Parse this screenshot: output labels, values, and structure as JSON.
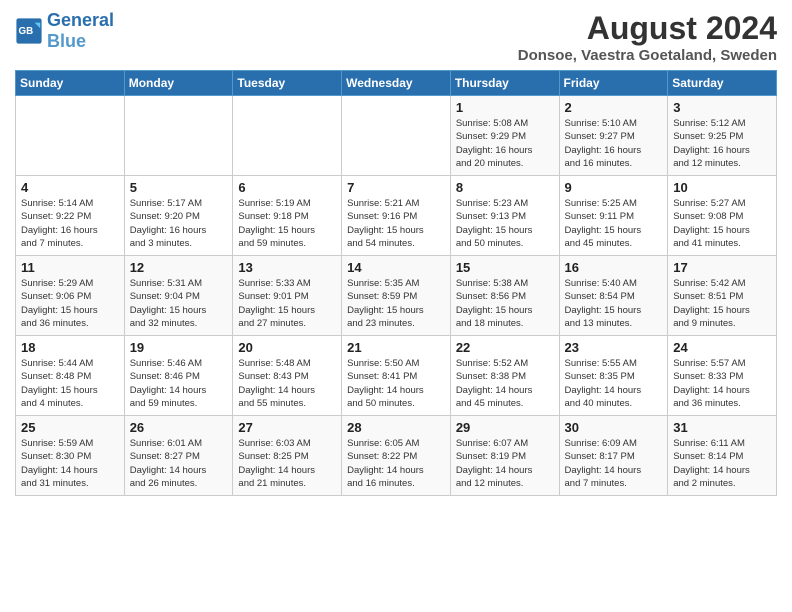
{
  "header": {
    "logo_general": "General",
    "logo_blue": "Blue",
    "month_year": "August 2024",
    "location": "Donsoe, Vaestra Goetaland, Sweden"
  },
  "weekdays": [
    "Sunday",
    "Monday",
    "Tuesday",
    "Wednesday",
    "Thursday",
    "Friday",
    "Saturday"
  ],
  "weeks": [
    [
      {
        "day": "",
        "info": ""
      },
      {
        "day": "",
        "info": ""
      },
      {
        "day": "",
        "info": ""
      },
      {
        "day": "",
        "info": ""
      },
      {
        "day": "1",
        "info": "Sunrise: 5:08 AM\nSunset: 9:29 PM\nDaylight: 16 hours\nand 20 minutes."
      },
      {
        "day": "2",
        "info": "Sunrise: 5:10 AM\nSunset: 9:27 PM\nDaylight: 16 hours\nand 16 minutes."
      },
      {
        "day": "3",
        "info": "Sunrise: 5:12 AM\nSunset: 9:25 PM\nDaylight: 16 hours\nand 12 minutes."
      }
    ],
    [
      {
        "day": "4",
        "info": "Sunrise: 5:14 AM\nSunset: 9:22 PM\nDaylight: 16 hours\nand 7 minutes."
      },
      {
        "day": "5",
        "info": "Sunrise: 5:17 AM\nSunset: 9:20 PM\nDaylight: 16 hours\nand 3 minutes."
      },
      {
        "day": "6",
        "info": "Sunrise: 5:19 AM\nSunset: 9:18 PM\nDaylight: 15 hours\nand 59 minutes."
      },
      {
        "day": "7",
        "info": "Sunrise: 5:21 AM\nSunset: 9:16 PM\nDaylight: 15 hours\nand 54 minutes."
      },
      {
        "day": "8",
        "info": "Sunrise: 5:23 AM\nSunset: 9:13 PM\nDaylight: 15 hours\nand 50 minutes."
      },
      {
        "day": "9",
        "info": "Sunrise: 5:25 AM\nSunset: 9:11 PM\nDaylight: 15 hours\nand 45 minutes."
      },
      {
        "day": "10",
        "info": "Sunrise: 5:27 AM\nSunset: 9:08 PM\nDaylight: 15 hours\nand 41 minutes."
      }
    ],
    [
      {
        "day": "11",
        "info": "Sunrise: 5:29 AM\nSunset: 9:06 PM\nDaylight: 15 hours\nand 36 minutes."
      },
      {
        "day": "12",
        "info": "Sunrise: 5:31 AM\nSunset: 9:04 PM\nDaylight: 15 hours\nand 32 minutes."
      },
      {
        "day": "13",
        "info": "Sunrise: 5:33 AM\nSunset: 9:01 PM\nDaylight: 15 hours\nand 27 minutes."
      },
      {
        "day": "14",
        "info": "Sunrise: 5:35 AM\nSunset: 8:59 PM\nDaylight: 15 hours\nand 23 minutes."
      },
      {
        "day": "15",
        "info": "Sunrise: 5:38 AM\nSunset: 8:56 PM\nDaylight: 15 hours\nand 18 minutes."
      },
      {
        "day": "16",
        "info": "Sunrise: 5:40 AM\nSunset: 8:54 PM\nDaylight: 15 hours\nand 13 minutes."
      },
      {
        "day": "17",
        "info": "Sunrise: 5:42 AM\nSunset: 8:51 PM\nDaylight: 15 hours\nand 9 minutes."
      }
    ],
    [
      {
        "day": "18",
        "info": "Sunrise: 5:44 AM\nSunset: 8:48 PM\nDaylight: 15 hours\nand 4 minutes."
      },
      {
        "day": "19",
        "info": "Sunrise: 5:46 AM\nSunset: 8:46 PM\nDaylight: 14 hours\nand 59 minutes."
      },
      {
        "day": "20",
        "info": "Sunrise: 5:48 AM\nSunset: 8:43 PM\nDaylight: 14 hours\nand 55 minutes."
      },
      {
        "day": "21",
        "info": "Sunrise: 5:50 AM\nSunset: 8:41 PM\nDaylight: 14 hours\nand 50 minutes."
      },
      {
        "day": "22",
        "info": "Sunrise: 5:52 AM\nSunset: 8:38 PM\nDaylight: 14 hours\nand 45 minutes."
      },
      {
        "day": "23",
        "info": "Sunrise: 5:55 AM\nSunset: 8:35 PM\nDaylight: 14 hours\nand 40 minutes."
      },
      {
        "day": "24",
        "info": "Sunrise: 5:57 AM\nSunset: 8:33 PM\nDaylight: 14 hours\nand 36 minutes."
      }
    ],
    [
      {
        "day": "25",
        "info": "Sunrise: 5:59 AM\nSunset: 8:30 PM\nDaylight: 14 hours\nand 31 minutes."
      },
      {
        "day": "26",
        "info": "Sunrise: 6:01 AM\nSunset: 8:27 PM\nDaylight: 14 hours\nand 26 minutes."
      },
      {
        "day": "27",
        "info": "Sunrise: 6:03 AM\nSunset: 8:25 PM\nDaylight: 14 hours\nand 21 minutes."
      },
      {
        "day": "28",
        "info": "Sunrise: 6:05 AM\nSunset: 8:22 PM\nDaylight: 14 hours\nand 16 minutes."
      },
      {
        "day": "29",
        "info": "Sunrise: 6:07 AM\nSunset: 8:19 PM\nDaylight: 14 hours\nand 12 minutes."
      },
      {
        "day": "30",
        "info": "Sunrise: 6:09 AM\nSunset: 8:17 PM\nDaylight: 14 hours\nand 7 minutes."
      },
      {
        "day": "31",
        "info": "Sunrise: 6:11 AM\nSunset: 8:14 PM\nDaylight: 14 hours\nand 2 minutes."
      }
    ]
  ]
}
